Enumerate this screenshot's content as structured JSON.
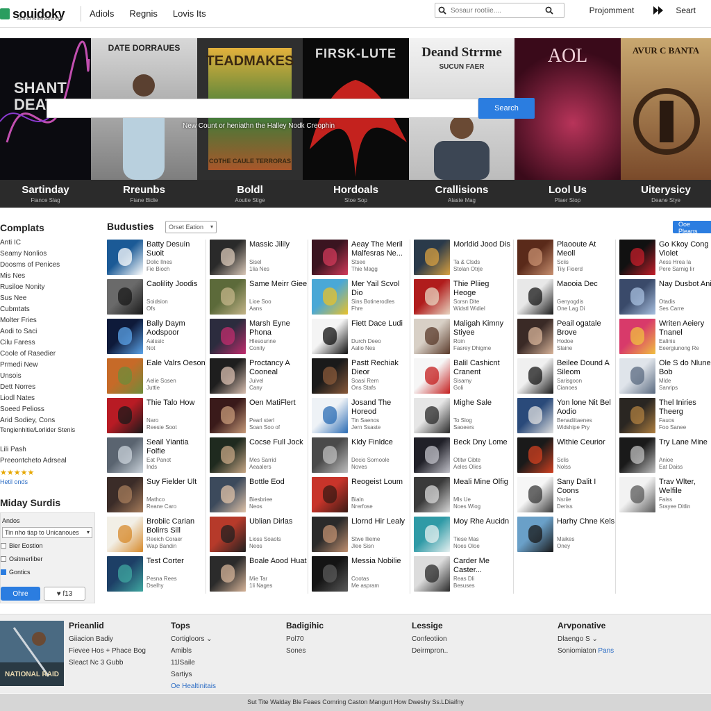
{
  "header": {
    "logo": "souidoky",
    "logo_tag": "Sound Entertainment",
    "nav": [
      "Adiols",
      "Regnis",
      "Lovis Its"
    ],
    "search_placeholder": "Sosaur rootiie....",
    "right_link": "Projomment",
    "start": "Seart"
  },
  "hero": {
    "search_button": "Search",
    "hint": "New Count or heniathn the Halley Nodk Creophin",
    "posters": [
      {
        "art_title": "SHANT DEATER",
        "caption": "Sartinday",
        "sub": "Fiance Slag"
      },
      {
        "art_title": "DATE DORRAUES",
        "caption": "Rreunbs",
        "sub": "Fiane Bidie"
      },
      {
        "art_title": "TEADMAKES",
        "art_sub": "COTHE CAULE TERRORAS",
        "caption": "Boldl",
        "sub": "Aoutie Stige"
      },
      {
        "art_title": "FIRSK-LUTE",
        "caption": "Hordoals",
        "sub": "Stoe Sop"
      },
      {
        "art_title": "Deand Strrme",
        "art_sub": "SUCUN FAER",
        "caption": "Crallisions",
        "sub": "Alaste Mag"
      },
      {
        "art_title": "AOL",
        "caption": "Lool Us",
        "sub": "Plaer Stop"
      },
      {
        "art_title": "AVUR C BANTA",
        "caption": "Uiterysicy",
        "sub": "Deane Stye"
      }
    ]
  },
  "sidebar": {
    "title": "Complats",
    "items": [
      "Anti IC",
      "Seamy Nonlios",
      "Doosms of Penices",
      "Mis Nes",
      "Rusiloe Nonity",
      "Sus Nee",
      "Cubmtats",
      "Molter Fries",
      "Aodi to Saci",
      "Cilu Faress",
      "Coole of Rasedier",
      "Prmedi New",
      "Unsois",
      "Dett Norres",
      "Liodl Nates",
      "Soeed Pelioss",
      "Arid Sodiey, Cons",
      "Tengienhitie/Lorlider Stenis",
      "Lili Pash",
      "Preeontcheto Adrseal"
    ],
    "stars": "★★★★★",
    "link": "Hetil onds"
  },
  "mini_dock": {
    "title": "Miday Surdis",
    "label": "Andos",
    "select": "Tin nho tiap to Unicanoues",
    "checks": [
      {
        "label": "Bier Eostion",
        "checked": false
      },
      {
        "label": "Ositmerliber",
        "checked": false
      },
      {
        "label": "Gontics",
        "checked": true
      }
    ],
    "btn_primary": "Ohre",
    "btn_secondary": "♥ f13"
  },
  "grid": {
    "title": "Budusties",
    "sort": "Orset Eation",
    "right_button": "Ooe Pleans",
    "columns": [
      [
        {
          "title": "Batty Desuin Suoit",
          "m1": "Dolic Ilnes",
          "m2": "Fie Bioch",
          "color": "#1b5a96",
          "accent": "#ffffff"
        },
        {
          "title": "Caolility Joodis",
          "m1": "Soidsion",
          "m2": "Ofs",
          "color": "#6a6a6a",
          "accent": "#1a1a1a"
        },
        {
          "title": "Bally Daym Aodspoor",
          "m1": "Aalssic",
          "m2": "Not",
          "color": "#0e1a3a",
          "accent": "#5ba3e8"
        },
        {
          "title": "Eale Valrs Oeson",
          "m1": "Aelie Sosen",
          "m2": "Juttie",
          "color": "#c66a28",
          "accent": "#6e8c3a"
        },
        {
          "title": "Thie Talo How",
          "m1": "Naro",
          "m2": "Reesie Soot",
          "color": "#b81b24",
          "accent": "#1a1a1a"
        },
        {
          "title": "Seail Yiantia Folfie",
          "m1": "Eat Panot",
          "m2": "Inds",
          "color": "#5a6470",
          "accent": "#c9d2da"
        },
        {
          "title": "Suy Fielder Ult",
          "m1": "Mathco",
          "m2": "Reane Caro",
          "color": "#3b2c28",
          "accent": "#a67c5b"
        },
        {
          "title": "Brobiic Carian Bolirrs Sill",
          "m1": "Reeich Coraer",
          "m2": "Wap Bandin",
          "color": "#f2efe6",
          "accent": "#d78a2b"
        },
        {
          "title": "Test Corter",
          "m1": "Pesna Rees",
          "m2": "Dselhy",
          "color": "#1d3f66",
          "accent": "#3fa7a0"
        }
      ],
      [
        {
          "title": "Massic Jilily",
          "m1": "Sisel",
          "m2": "1lia Nes",
          "color": "#2a2a2a",
          "accent": "#d9c8b8"
        },
        {
          "title": "Same Meirr Giee",
          "m1": "Lioe Soo",
          "m2": "Aans",
          "color": "#5c6a3a",
          "accent": "#c4b58a"
        },
        {
          "title": "Marsh Eyne Phona",
          "m1": "Hlesounne",
          "m2": "Conity",
          "color": "#2c2c3e",
          "accent": "#c22c6e"
        },
        {
          "title": "Proctancy A Cooneal",
          "m1": "Juivel",
          "m2": "Cany",
          "color": "#1e1e1e",
          "accent": "#d9bfb0"
        },
        {
          "title": "Oen MatiFlert",
          "m1": "Pearl sterl",
          "m2": "Soan Soo of",
          "color": "#3a1a1a",
          "accent": "#c79b7a"
        },
        {
          "title": "Cocse Full Jock",
          "m1": "Mes Sarrid",
          "m2": "Aeaalers",
          "color": "#1f2a1f",
          "accent": "#c7a786"
        },
        {
          "title": "Bottle Eod",
          "m1": "Biesbriee",
          "m2": "Neos",
          "color": "#3c4a5c",
          "accent": "#e0c3a8"
        },
        {
          "title": "Ublian Dirlas",
          "m1": "Lioss Soaots",
          "m2": "Neos",
          "color": "#b63a2a",
          "accent": "#202020"
        },
        {
          "title": "Boale Aood Huat",
          "m1": "Mie Tar",
          "m2": "1li Nages",
          "color": "#2b2b2b",
          "accent": "#d6b499"
        }
      ],
      [
        {
          "title": "Aeay The Meril Malfesras Ne...",
          "m1": "Stsee",
          "m2": "Thie Magg",
          "color": "#3a1420",
          "accent": "#d23a5a"
        },
        {
          "title": "Mer Yail Scvol Dio",
          "m1": "Sins Botinerodles",
          "m2": "Fhre",
          "color": "#4aa8d6",
          "accent": "#e8c12b"
        },
        {
          "title": "Fiett Dace Ludi",
          "m1": "Durch Deeo",
          "m2": "Aalio Nes",
          "color": "#f4f4f4",
          "accent": "#111111"
        },
        {
          "title": "Pastt Rechiak Dieor",
          "m1": "Soasi Rern",
          "m2": "Ons Stafs",
          "color": "#1a1a1a",
          "accent": "#8a5a3a"
        },
        {
          "title": "Josand The Horeod",
          "m1": "Tin Saenos",
          "m2": "Jern Ssaste",
          "color": "#eef2f6",
          "accent": "#2b6cb4"
        },
        {
          "title": "Kldy Finldce",
          "m1": "Decio Sornoole",
          "m2": "Noves",
          "color": "#4a4a4a",
          "accent": "#bfbfbf"
        },
        {
          "title": "Reogeist Loum",
          "m1": "Bialn",
          "m2": "Nrerfose",
          "color": "#c8342a",
          "accent": "#3a1a14"
        },
        {
          "title": "Llornd Hir Lealy",
          "m1": "Stwe Ilieme",
          "m2": "Jlee Sisn",
          "color": "#2a2a2a",
          "accent": "#c09070"
        },
        {
          "title": "Messia Nobilie",
          "m1": "Cootas",
          "m2": "Me aspram",
          "color": "#141414",
          "accent": "#5a5a5a"
        }
      ],
      [
        {
          "title": "Morldid Jood Dis",
          "m1": "Ta & Clsds",
          "m2": "Stolan Otrje",
          "color": "#2a3a4a",
          "accent": "#d8a040"
        },
        {
          "title": "Thie Pliieg Heoge",
          "m1": "Sorsn Dite",
          "m2": "Widstl Widiel",
          "color": "#b01c1c",
          "accent": "#e8d4c0"
        },
        {
          "title": "Maligah Kimny Stiyee",
          "m1": "Roin",
          "m2": "Fasrey Dhigme",
          "color": "#d8d0c6",
          "accent": "#5a3a2a"
        },
        {
          "title": "Balil Cashicnt Cranent",
          "m1": "Sisamy",
          "m2": "Goli",
          "color": "#f6f6f6",
          "accent": "#c41e1e"
        },
        {
          "title": "Mighe Sale",
          "m1": "To Slog",
          "m2": "Saoeers",
          "color": "#e6e6e6",
          "accent": "#2a2a2a"
        },
        {
          "title": "Beck Dny Lome",
          "m1": "Otitw Cibte",
          "m2": "Aeles Olies",
          "color": "#202028",
          "accent": "#c0c0c8"
        },
        {
          "title": "Meali Mine Olfig",
          "m1": "Mls Ue",
          "m2": "Noes Wiog",
          "color": "#3a3a3a",
          "accent": "#d8d8d8"
        },
        {
          "title": "Moy Rhe Aucidn",
          "m1": "Tiese Mas",
          "m2": "Noes Oloe",
          "color": "#2f9aa6",
          "accent": "#e6f0f0"
        },
        {
          "title": "Carder Me Caster...",
          "m1": "Reas Dli",
          "m2": "Besuses",
          "color": "#dcdcdc",
          "accent": "#2a2a2a"
        }
      ],
      [
        {
          "title": "Plaooute At Meoll",
          "m1": "Sciis",
          "m2": "Tiiy Fioerd",
          "color": "#5a2a1a",
          "accent": "#c89070"
        },
        {
          "title": "Maooia Dec",
          "m1": "Genyogdis",
          "m2": "One Lag Di",
          "color": "#e8e8e8",
          "accent": "#1a1a1a"
        },
        {
          "title": "Peail ogatale Brove",
          "m1": "Hodoe",
          "m2": "Slaine",
          "color": "#3a2a26",
          "accent": "#d8b49a"
        },
        {
          "title": "Beilee Dound A Sileom",
          "m1": "Sarisgoon",
          "m2": "Cianoes",
          "color": "#f0f0f0",
          "accent": "#1a1a1a"
        },
        {
          "title": "Yon lone Nit Bel Aodio",
          "m1": "Benadiitaenes",
          "m2": "Widshipe Pry",
          "color": "#2a4a7a",
          "accent": "#e0e0e0"
        },
        {
          "title": "Wlthie Ceurior",
          "m1": "Sclis",
          "m2": "Nolss",
          "color": "#1a1a1a",
          "accent": "#d04020"
        },
        {
          "title": "Sany Dalit I Coons",
          "m1": "Nsriie",
          "m2": "Deriss",
          "color": "#f6f6f6",
          "accent": "#3a3a3a"
        },
        {
          "title": "Harhy Chne Kels",
          "m1": "Maikes",
          "m2": "Oney",
          "color": "#6aa0c8",
          "accent": "#1a1a1a"
        }
      ],
      [
        {
          "title": "Go Kkoy Cong Violet",
          "m1": "Aess Hrea Ia",
          "m2": "Pere Sarnig Iir",
          "color": "#111111",
          "accent": "#c41e2a"
        },
        {
          "title": "Nay Dusbot Anid",
          "m1": "Otadis",
          "m2": "Ses Carre",
          "color": "#3a4a6a",
          "accent": "#a8c0e0"
        },
        {
          "title": "Writen Aeiery Tnanel",
          "m1": "Ealinis",
          "m2": "Eeergiunong Re",
          "color": "#d83a6a",
          "accent": "#f0c040"
        },
        {
          "title": "Ole S do Nlune Bob",
          "m1": "Mlde",
          "m2": "Sanrips",
          "color": "#dfe4ea",
          "accent": "#5a6a80"
        },
        {
          "title": "Thel Iniries Theerg",
          "m1": "Fauos",
          "m2": "Foo Sanee",
          "color": "#2a2622",
          "accent": "#b08040"
        },
        {
          "title": "Try Lane Mine",
          "m1": "Anioe",
          "m2": "Eat Daiss",
          "color": "#1a1a1a",
          "accent": "#c0c0c0"
        },
        {
          "title": "Trav Wlter, Welfile",
          "m1": "Faiss",
          "m2": "Srayee Ditlin",
          "color": "#f2f2f2",
          "accent": "#5a5a5a"
        }
      ]
    ]
  },
  "footer": {
    "feature": {
      "art_text": "NATIONAL RAID",
      "title": "Prieanlid",
      "lines": [
        "Giiacion Badiy",
        "Fievee Hos + Phace Bog",
        "Sleact Nc 3 Gubb"
      ]
    },
    "cols": [
      {
        "head": "Tops",
        "items": [
          "Cortigloors ⌄",
          "Amibls",
          "11lSaile",
          "Sartiys"
        ],
        "link": "Oe Healtinitais"
      },
      {
        "head": "Badigihic",
        "items": [
          "Pol70",
          "Sones"
        ]
      },
      {
        "head": "Lessige",
        "items": [
          "Confeotiion",
          "Deirmpron.."
        ]
      },
      {
        "head": "Arvponative",
        "items": [
          "Dlaengo S ⌄"
        ],
        "link_line": {
          "prefix": "Soniomiaton ",
          "link": "Pans"
        }
      }
    ],
    "bottom": "Sut Tite Walday Ble Feaes Comring Caston Mangurt How Dweshy Ss.LDiaifny"
  },
  "colors": {
    "accent": "#2b7de0",
    "link": "#2b6cc4",
    "caption_bar": "#2b2b2b"
  }
}
